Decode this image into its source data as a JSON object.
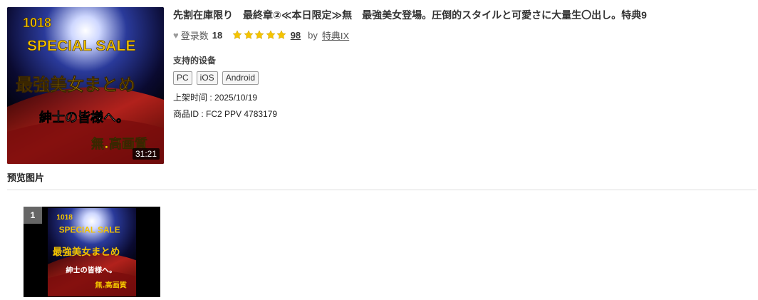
{
  "product": {
    "title": "先割在庫限り　最終章②≪本日限定≫無　最強美女登場。圧倒的スタイルと可愛さに大量生〇出し。特典9",
    "duration": "31:21",
    "favorites_label": "登录数",
    "favorites_count": "18",
    "rating_stars": 5,
    "rating_count": "98",
    "by_label": "by",
    "seller": "特典IX",
    "devices_label": "支持的设备",
    "devices": [
      "PC",
      "iOS",
      "Android"
    ],
    "release_label": "上架时间 : ",
    "release_date": "2025/10/19",
    "product_id_label": "商品ID : ",
    "product_id": "FC2 PPV 4783179"
  },
  "thumbnail": {
    "line1": "1018",
    "line2": "SPECIAL SALE",
    "line3": "最強美女まとめ",
    "line4": "紳士の皆様へ。",
    "line5": "無.高画質"
  },
  "preview": {
    "heading": "预览图片",
    "items": [
      {
        "number": "1"
      }
    ]
  },
  "colors": {
    "star": "#f5c400",
    "thumb_text_gold": "#f2c200",
    "thumb_bg_red": "#8a0f0f",
    "thumb_bg_dark": "#0a0a30"
  }
}
